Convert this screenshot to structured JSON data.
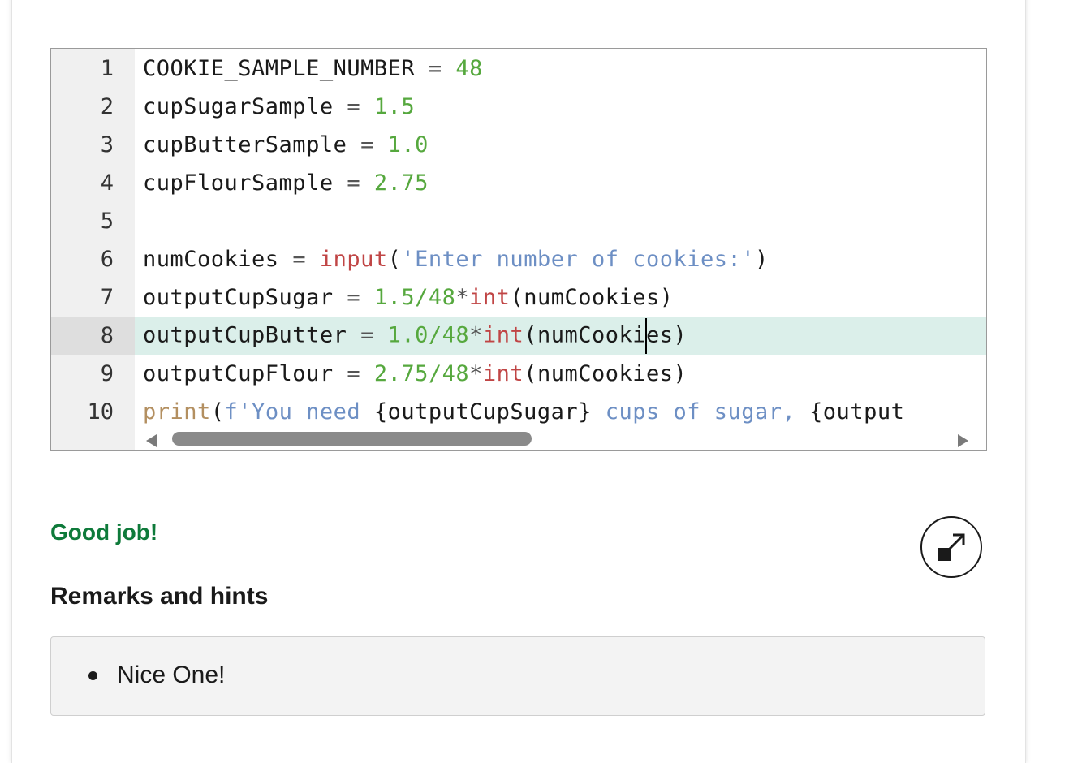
{
  "editor": {
    "active_line": 8,
    "lines": [
      {
        "number": "1",
        "tokens": [
          {
            "t": "COOKIE_SAMPLE_NUMBER",
            "c": "plain"
          },
          {
            "t": " = ",
            "c": "op"
          },
          {
            "t": "48",
            "c": "num"
          }
        ]
      },
      {
        "number": "2",
        "tokens": [
          {
            "t": "cupSugarSample",
            "c": "plain"
          },
          {
            "t": " = ",
            "c": "op"
          },
          {
            "t": "1.5",
            "c": "num"
          }
        ]
      },
      {
        "number": "3",
        "tokens": [
          {
            "t": "cupButterSample",
            "c": "plain"
          },
          {
            "t": " = ",
            "c": "op"
          },
          {
            "t": "1.0",
            "c": "num"
          }
        ]
      },
      {
        "number": "4",
        "tokens": [
          {
            "t": "cupFlourSample",
            "c": "plain"
          },
          {
            "t": " = ",
            "c": "op"
          },
          {
            "t": "2.75",
            "c": "num"
          }
        ]
      },
      {
        "number": "5",
        "tokens": []
      },
      {
        "number": "6",
        "tokens": [
          {
            "t": "numCookies",
            "c": "plain"
          },
          {
            "t": " = ",
            "c": "op"
          },
          {
            "t": "input",
            "c": "builtin"
          },
          {
            "t": "(",
            "c": "plain"
          },
          {
            "t": "'Enter number of cookies:'",
            "c": "str"
          },
          {
            "t": ")",
            "c": "plain"
          }
        ]
      },
      {
        "number": "7",
        "tokens": [
          {
            "t": "outputCupSugar",
            "c": "plain"
          },
          {
            "t": " = ",
            "c": "op"
          },
          {
            "t": "1.5/48",
            "c": "num"
          },
          {
            "t": "*",
            "c": "op"
          },
          {
            "t": "int",
            "c": "builtin"
          },
          {
            "t": "(numCookies)",
            "c": "plain"
          }
        ]
      },
      {
        "number": "8",
        "tokens": [
          {
            "t": "outputCupButter",
            "c": "plain"
          },
          {
            "t": " = ",
            "c": "op"
          },
          {
            "t": "1.0/48",
            "c": "num"
          },
          {
            "t": "*",
            "c": "op"
          },
          {
            "t": "int",
            "c": "builtin"
          },
          {
            "t": "(numCooki",
            "c": "plain"
          },
          {
            "t": "|",
            "c": "cursor"
          },
          {
            "t": "es)",
            "c": "plain"
          }
        ]
      },
      {
        "number": "9",
        "tokens": [
          {
            "t": "outputCupFlour",
            "c": "plain"
          },
          {
            "t": " = ",
            "c": "op"
          },
          {
            "t": "2.75/48",
            "c": "num"
          },
          {
            "t": "*",
            "c": "op"
          },
          {
            "t": "int",
            "c": "builtin"
          },
          {
            "t": "(numCookies)",
            "c": "plain"
          }
        ]
      },
      {
        "number": "10",
        "tokens": [
          {
            "t": "print",
            "c": "print"
          },
          {
            "t": "(",
            "c": "plain"
          },
          {
            "t": "f'You need ",
            "c": "str"
          },
          {
            "t": "{outputCupSugar}",
            "c": "plain"
          },
          {
            "t": " cups of sugar, ",
            "c": "str"
          },
          {
            "t": "{output",
            "c": "plain"
          }
        ]
      }
    ]
  },
  "feedback": {
    "message": "Good job!",
    "color": "#0e7a3a"
  },
  "remarks": {
    "title": "Remarks and hints",
    "items": [
      "Nice One!"
    ]
  },
  "icons": {
    "expand": "expand-icon",
    "scroll_left": "arrow-left-icon",
    "scroll_right": "arrow-right-icon"
  }
}
